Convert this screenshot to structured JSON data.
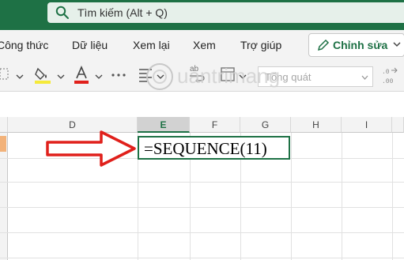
{
  "search": {
    "text": "Tìm kiếm (Alt + Q)",
    "icon": "search-icon"
  },
  "menu": {
    "items": [
      "Công thức",
      "Dữ liệu",
      "Xem lại",
      "Xem",
      "Trợ giúp"
    ],
    "edit_label": "Chỉnh sửa"
  },
  "ribbon": {
    "number_format": "Tổng quát"
  },
  "grid": {
    "columns": [
      "D",
      "E",
      "F",
      "G",
      "H",
      "I"
    ],
    "selected_column": "E",
    "active_cell_text": "=SEQUENCE(11)"
  },
  "colors": {
    "accent": "#1e7145",
    "arrow": "#e0201b"
  }
}
